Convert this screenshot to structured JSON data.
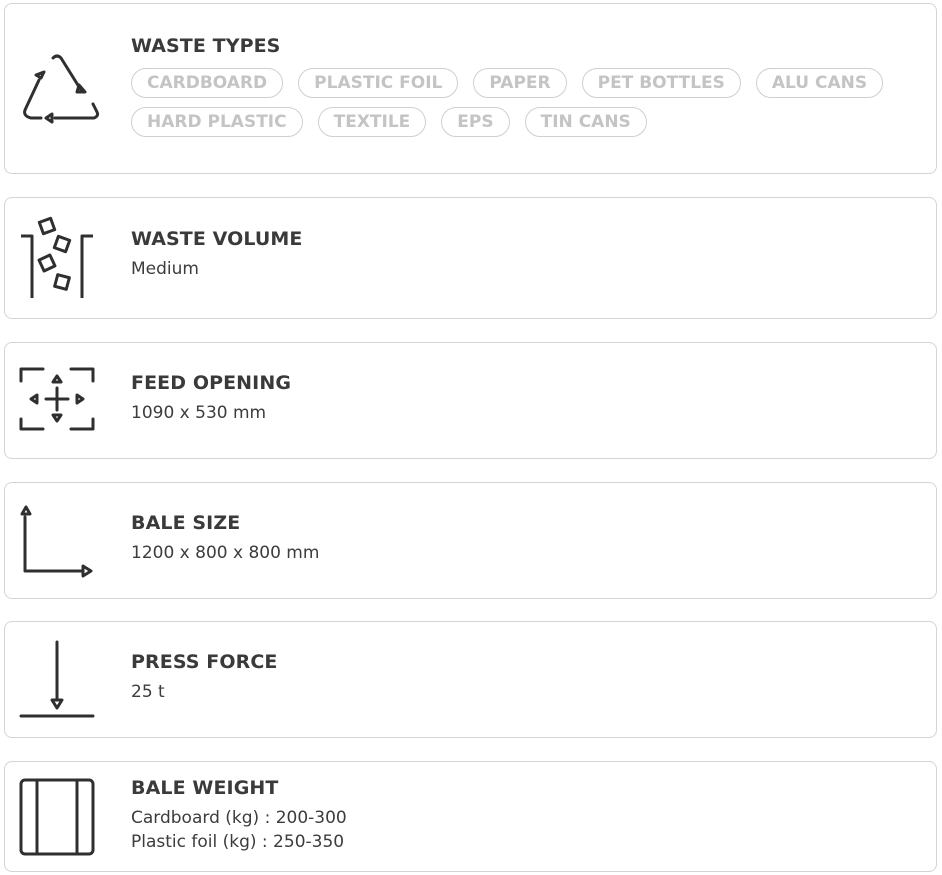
{
  "cards": {
    "waste_types": {
      "title": "WASTE TYPES",
      "icon": "recycle-icon",
      "tags": [
        "CARDBOARD",
        "PLASTIC FOIL",
        "PAPER",
        "PET BOTTLES",
        "ALU CANS",
        "HARD PLASTIC",
        "TEXTILE",
        "EPS",
        "TIN CANS"
      ]
    },
    "waste_volume": {
      "title": "WASTE VOLUME",
      "value": "Medium",
      "icon": "bin-icon"
    },
    "feed_opening": {
      "title": "FEED OPENING",
      "value": "1090 x 530 mm",
      "icon": "feed-opening-icon"
    },
    "bale_size": {
      "title": "BALE SIZE",
      "value": "1200 x 800 x 800 mm",
      "icon": "bale-size-icon"
    },
    "press_force": {
      "title": "PRESS FORCE",
      "value": "25 t",
      "icon": "press-force-icon"
    },
    "bale_weight": {
      "title": "BALE WEIGHT",
      "icon": "bale-weight-icon",
      "lines": [
        "Cardboard (kg) : 200-300",
        "Plastic foil (kg) : 250-350"
      ]
    }
  },
  "colors": {
    "border": "#d4d4d4",
    "text": "#3c3c3c",
    "tag_text": "#c4c4c4",
    "icon_stroke": "#2f2f2f"
  }
}
